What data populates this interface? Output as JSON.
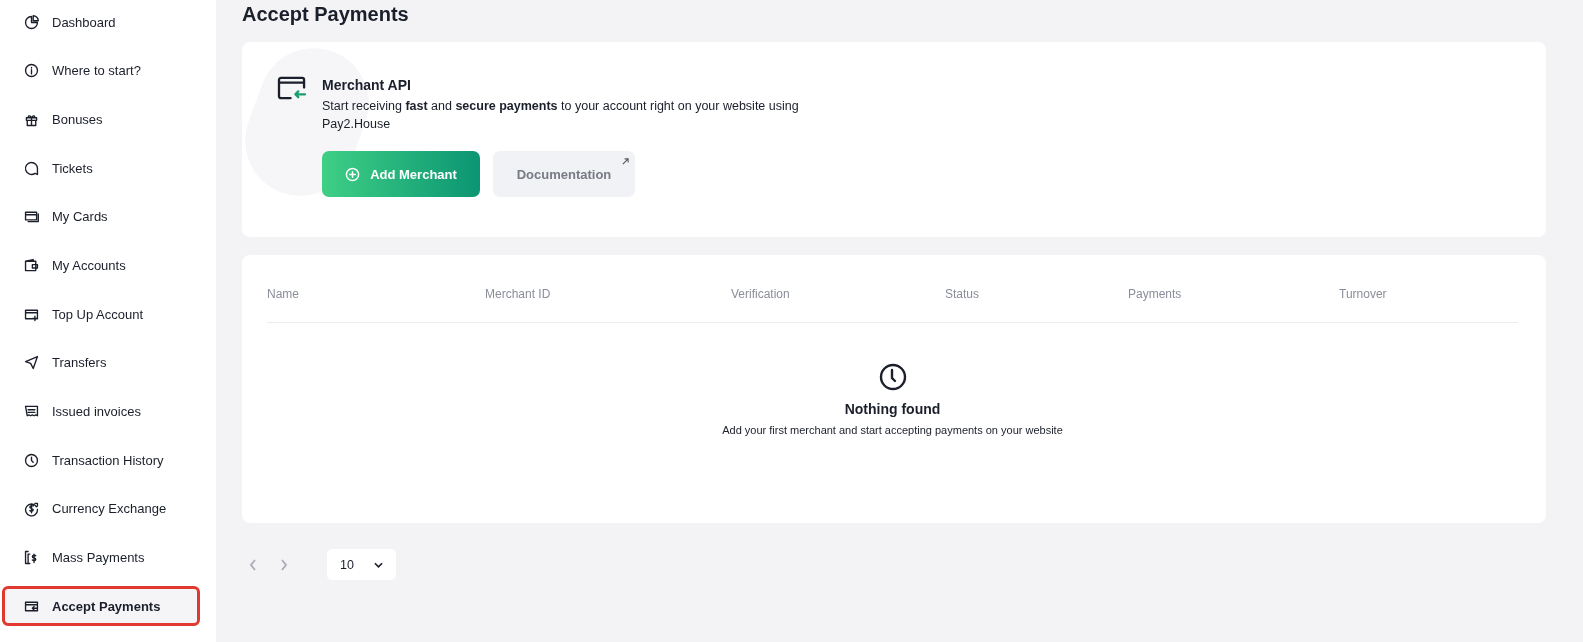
{
  "sidebar": {
    "items": [
      {
        "label": "Dashboard",
        "selected": false
      },
      {
        "label": "Where to start?",
        "selected": false
      },
      {
        "label": "Bonuses",
        "selected": false
      },
      {
        "label": "Tickets",
        "selected": false
      },
      {
        "label": "My Cards",
        "selected": false
      },
      {
        "label": "My Accounts",
        "selected": false
      },
      {
        "label": "Top Up Account",
        "selected": false
      },
      {
        "label": "Transfers",
        "selected": false
      },
      {
        "label": "Issued invoices",
        "selected": false
      },
      {
        "label": "Transaction History",
        "selected": false
      },
      {
        "label": "Currency Exchange",
        "selected": false
      },
      {
        "label": "Mass Payments",
        "selected": false
      },
      {
        "label": "Accept Payments",
        "selected": true
      }
    ]
  },
  "page": {
    "title": "Accept Payments"
  },
  "merchant_card": {
    "title": "Merchant API",
    "description": "Start receiving **fast** and **secure payments** to your account right on your website using Pay2.House",
    "buttons": [
      "Add Merchant",
      "Documentation"
    ]
  },
  "table": {
    "columns": [
      "Name",
      "Merchant ID",
      "Verification",
      "Status",
      "Payments",
      "Turnover"
    ],
    "empty": {
      "title": "Nothing found",
      "message": "Add your first merchant and start accepting payments on your website"
    }
  },
  "pagination": {
    "page_size": "10"
  }
}
